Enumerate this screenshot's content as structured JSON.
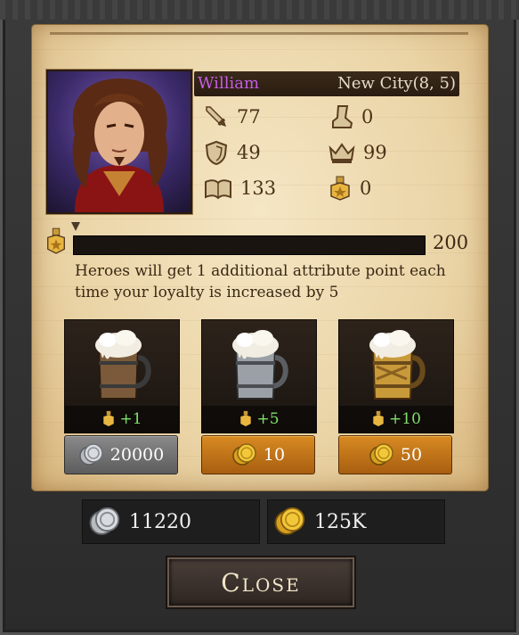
{
  "hero": {
    "name": "William",
    "city": "New City(8, 5)",
    "stats": {
      "attack": "77",
      "defense": "49",
      "intelligence": "133",
      "speed": "0",
      "politics": "99",
      "loyalty": "0"
    }
  },
  "loyalty": {
    "current": 0,
    "max": "200",
    "description": "Heroes will get 1 additional attribute point each time your loyalty is increased by 5"
  },
  "ales": [
    {
      "gain": "+1",
      "cost": "20000",
      "currency": "silver"
    },
    {
      "gain": "+5",
      "cost": "10",
      "currency": "gold"
    },
    {
      "gain": "+10",
      "cost": "50",
      "currency": "gold"
    }
  ],
  "wallet": {
    "silver": "11220",
    "gold": "125K"
  },
  "close_label": "Close",
  "icons": {
    "attack": "sword-icon",
    "defense": "shield-icon",
    "intelligence": "book-icon",
    "speed": "boot-icon",
    "politics": "crown-icon",
    "loyalty": "loyalty-medal-icon",
    "silver": "silver-coin-icon",
    "gold": "gold-coin-icon"
  },
  "colors": {
    "hero_name": "#c65ce6",
    "gain_text": "#7fe06a",
    "gold_button": "#d88a22",
    "silver_button": "#8a8a8a"
  }
}
